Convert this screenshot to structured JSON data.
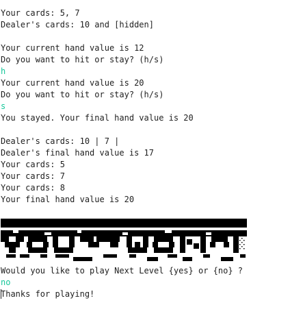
{
  "console": {
    "lines_before_banner": [
      {
        "text": "Your cards: 5, 7",
        "kind": "output"
      },
      {
        "text": "Dealer's cards: 10 and [hidden]",
        "kind": "output"
      },
      {
        "text": "",
        "kind": "blank"
      },
      {
        "text": "Your current hand value is 12",
        "kind": "output"
      },
      {
        "text": "Do you want to hit or stay? (h/s)",
        "kind": "output"
      },
      {
        "text": "h",
        "kind": "input"
      },
      {
        "text": "Your current hand value is 20",
        "kind": "output"
      },
      {
        "text": "Do you want to hit or stay? (h/s)",
        "kind": "output"
      },
      {
        "text": "s",
        "kind": "input"
      },
      {
        "text": "You stayed. Your final hand value is 20",
        "kind": "output"
      },
      {
        "text": "",
        "kind": "blank"
      },
      {
        "text": "Dealer's cards: 10 | 7 |",
        "kind": "output"
      },
      {
        "text": "Dealer's final hand value is 17",
        "kind": "output"
      },
      {
        "text": "Your cards: 5",
        "kind": "output"
      },
      {
        "text": "Your cards: 7",
        "kind": "output"
      },
      {
        "text": "Your cards: 8",
        "kind": "output"
      },
      {
        "text": "Your final hand value is 20",
        "kind": "output"
      },
      {
        "text": "",
        "kind": "blank"
      }
    ],
    "banner": {
      "meaning": "YOU WON",
      "color": "#000000"
    },
    "lines_after_banner": [
      {
        "text": "Would you like to play Next Level {yes} or {no} ?",
        "kind": "output"
      },
      {
        "text": "no",
        "kind": "input"
      },
      {
        "text": "Thanks for playing!",
        "kind": "output",
        "caret": true
      }
    ]
  },
  "colors": {
    "text": "#1e1e1e",
    "input": "#16c79a",
    "background": "#ffffff"
  }
}
